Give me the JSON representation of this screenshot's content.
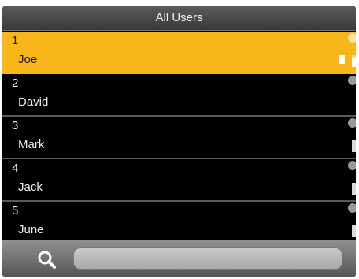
{
  "header": {
    "title": "All Users"
  },
  "users": [
    {
      "number": "1",
      "name": "Joe",
      "selected": true
    },
    {
      "number": "2",
      "name": "David",
      "selected": false
    },
    {
      "number": "3",
      "name": "Mark",
      "selected": false
    },
    {
      "number": "4",
      "name": "Jack",
      "selected": false
    },
    {
      "number": "5",
      "name": "June",
      "selected": false
    }
  ],
  "search": {
    "value": ""
  },
  "colors": {
    "selected_row": "#f9b61a",
    "background": "#000000"
  },
  "icons": {
    "search": "search-icon",
    "status": "status-icon",
    "card": "card-icon",
    "key": "key-icon"
  }
}
